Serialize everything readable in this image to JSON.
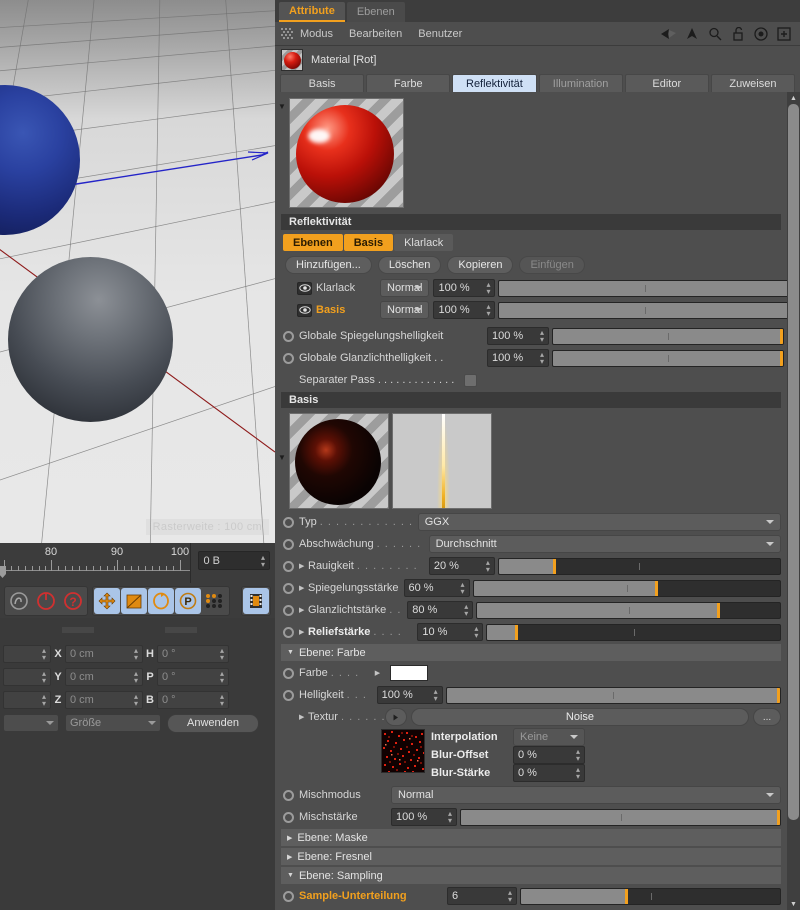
{
  "panel": {
    "tabs": [
      {
        "label": "Attribute",
        "selected": true
      },
      {
        "label": "Ebenen",
        "selected": false
      }
    ],
    "menu": [
      "Modus",
      "Bearbeiten",
      "Benutzer"
    ],
    "header_icons": [
      "back-arrow-icon",
      "forward-arrow-icon",
      "up-arrow-icon",
      "search-icon",
      "lock-icon",
      "target-icon",
      "plus-box-icon"
    ],
    "material_title": "Material [Rot]",
    "material_tabs": [
      {
        "label": "Basis",
        "selected": false
      },
      {
        "label": "Farbe",
        "selected": false
      },
      {
        "label": "Reflektivität",
        "selected": true
      },
      {
        "label": "Illumination",
        "selected": false,
        "dim": true
      },
      {
        "label": "Editor",
        "selected": false
      },
      {
        "label": "Zuweisen",
        "selected": false
      }
    ]
  },
  "reflectivity": {
    "section_title": "Reflektivität",
    "segments": [
      {
        "label": "Ebenen",
        "on": true
      },
      {
        "label": "Basis",
        "on": true
      },
      {
        "label": "Klarlack",
        "on": false
      }
    ],
    "buttons": [
      {
        "label": "Hinzufügen...",
        "disabled": false
      },
      {
        "label": "Löschen",
        "disabled": false
      },
      {
        "label": "Kopieren",
        "disabled": false
      },
      {
        "label": "Einfügen",
        "disabled": true
      }
    ],
    "layers": [
      {
        "name": "Klarlack",
        "mode": "Normal",
        "amount": "100 %",
        "amount_pct": 100,
        "selected": false
      },
      {
        "name": "Basis",
        "mode": "Normal",
        "amount": "100 %",
        "amount_pct": 100,
        "selected": true
      }
    ],
    "globals": [
      {
        "label": "Globale Spiegelungshelligkeit",
        "value": "100 %",
        "pct": 100
      },
      {
        "label": "Globale Glanzlichthelligkeit . .",
        "value": "100 %",
        "pct": 100
      }
    ],
    "separate_pass": {
      "label": "Separater Pass . . . . . . . . . . . . .",
      "checked": false
    }
  },
  "basis": {
    "section_title": "Basis",
    "type": {
      "label": "Typ",
      "dots": ". . . . . . . . . . . . .",
      "value": "GGX"
    },
    "falloff": {
      "label": "Abschwächung",
      "dots": ". . . . . .",
      "value": "Durchschnitt"
    },
    "sliders": [
      {
        "label": "Rauigkeit",
        "dots": ". . . . . . . .",
        "value": "20 %",
        "pct": 20,
        "bold": false
      },
      {
        "label": "Spiegelungsstärke",
        "dots": "",
        "value": "60 %",
        "pct": 60,
        "bold": false
      },
      {
        "label": "Glanzlichtstärke",
        "dots": ". .",
        "value": "80 %",
        "pct": 80,
        "bold": false
      },
      {
        "label": "Reliefstärke",
        "dots": ". . . .",
        "value": "10 %",
        "pct": 10,
        "bold": true
      }
    ]
  },
  "layer_color": {
    "title": "Ebene: Farbe",
    "color": {
      "label": "Farbe",
      "dots": ". . . .",
      "value_hex": "#ffffff"
    },
    "brightness": {
      "label": "Helligkeit",
      "dots": ". . .",
      "value": "100 %",
      "pct": 100
    },
    "texture": {
      "label": "Textur",
      "dots": ". . . . . .",
      "value": "Noise",
      "more_label": "..."
    },
    "interpolation": {
      "label": "Interpolation",
      "value": "Keine"
    },
    "blur_offset": {
      "label": "Blur-Offset",
      "value": "0 %"
    },
    "blur_strength": {
      "label": "Blur-Stärke",
      "value": "0 %"
    },
    "mix_mode": {
      "label": "Mischmodus",
      "value": "Normal"
    },
    "mix_strength": {
      "label": "Mischstärke",
      "value": "100 %",
      "pct": 100
    }
  },
  "collapsed_sections": [
    {
      "title": "Ebene: Maske",
      "open": false
    },
    {
      "title": "Ebene: Fresnel",
      "open": false
    },
    {
      "title": "Ebene: Sampling",
      "open": true
    }
  ],
  "sampling": {
    "subdivision": {
      "label": "Sample-Unterteilung",
      "value": "6",
      "pct": 41
    }
  },
  "viewport": {
    "hud_text": "Rasterweite : 100 cm",
    "ruler_labels": [
      "80",
      "90",
      "100"
    ],
    "frame_field": "0 B",
    "tools_left": [
      "spline-icon",
      "undo-circle-icon",
      "help-icon"
    ],
    "tools_mid": [
      "move-icon",
      "scale-icon",
      "rotate-icon",
      "p-circle-icon",
      "dotgrid-icon"
    ],
    "tools_right": [
      "filmstrip-icon"
    ]
  },
  "coords": {
    "rows": [
      {
        "axis": "X",
        "pos": "0 cm",
        "rot_axis": "H",
        "rot": "0 °"
      },
      {
        "axis": "Y",
        "pos": "0 cm",
        "rot_axis": "P",
        "rot": "0 °"
      },
      {
        "axis": "Z",
        "pos": "0 cm",
        "rot_axis": "B",
        "rot": "0 °"
      }
    ],
    "mode_select": "",
    "size_select": "Größe",
    "apply_button": "Anwenden"
  },
  "colors": {
    "accent_orange": "#f2a01e",
    "tab_selected_bg": "#cfe0f5",
    "panel_bg": "#4e4e4e"
  }
}
